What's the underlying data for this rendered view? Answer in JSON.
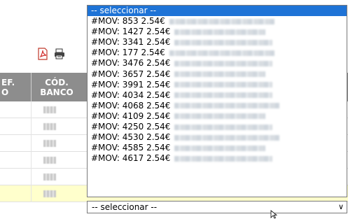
{
  "toolbar": {
    "icons": [
      "pdf-icon",
      "printer-icon"
    ]
  },
  "table": {
    "headers": {
      "ref": "EF.\nO",
      "banco": "CÓD.\nBANCO"
    },
    "row_count": 6
  },
  "select": {
    "value": "-- seleccionar --",
    "options": [
      "-- seleccionar --",
      "#MOV: 853 2.54€",
      "#MOV: 1427 2.54€",
      "#MOV: 3341 2.54€",
      "#MOV: 177 2.54€",
      "#MOV: 3476 2.54€",
      "#MOV: 3657 2.54€",
      "#MOV: 3991 2.54€",
      "#MOV: 4034 2.54€",
      "#MOV: 4068 2.54€",
      "#MOV: 4109 2.54€",
      "#MOV: 4250 2.54€",
      "#MOV: 4530 2.54€",
      "#MOV: 4585 2.54€",
      "#MOV: 4617 2.54€"
    ]
  },
  "colors": {
    "header_bg": "#8d8d8d",
    "selected_option": "#1e73d6",
    "highlight_row": "#ffffcc"
  }
}
